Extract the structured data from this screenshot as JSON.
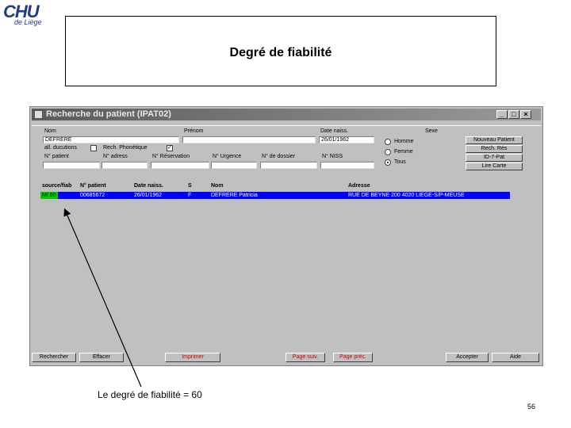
{
  "logo": {
    "mark": "CHU",
    "sub": "de Liège"
  },
  "slide_title": "Degré de fiabilité",
  "window": {
    "title": "Recherche du patient (IPAT02)",
    "buttons": {
      "minimize": "_",
      "maximize": "□",
      "close": "×"
    }
  },
  "form": {
    "nom_label": "Nom",
    "nom_value": "DEFRERE",
    "prenom_label": "Prénom",
    "prenom_value": "",
    "date_label": "Date naiss.",
    "date_value": "26/01/1962",
    "sexe_label": "Sexe",
    "all_doc_label": "all. ducutions",
    "phonetique_label": "Rech. Phonétique",
    "phonetique_checked": true,
    "patient_label": "N° patient",
    "adresse_label": "N° adress",
    "reservation_label": "N° Réservation",
    "urgence_label": "N° Urgence",
    "dossier_label": "N° de dossier",
    "niss_label": "N° NISS"
  },
  "sex_options": [
    {
      "label": "Homme",
      "selected": false
    },
    {
      "label": "Femme",
      "selected": false
    },
    {
      "label": "Tous",
      "selected": true
    }
  ],
  "side_buttons": [
    "Nouveau Patient",
    "Rech. Rés",
    "ID-7-Pat",
    "Lire Carte"
  ],
  "list": {
    "headers": [
      "source/fiab",
      "N° patient",
      "Date naiss.",
      "S",
      "Nom",
      "Adresse"
    ],
    "rows": [
      [
        "M/ 60",
        "00685672",
        "26/01/1962",
        "F",
        "DEFRERE Patricia",
        "RUE DE BEYNE 200 4020 LIEGE-S/P-MEUSE"
      ]
    ]
  },
  "bottom_buttons": [
    "Rechercher",
    "Effacer",
    "Imprimer",
    "Page suiv.",
    "Page préc.",
    "Accepter",
    "Aide"
  ],
  "caption": "Le degré de fiabilité = 60",
  "page_number": "56",
  "colors": {
    "selection": "#0000ff",
    "fiability": "#00cc00",
    "accent_red": "#cc0000"
  }
}
